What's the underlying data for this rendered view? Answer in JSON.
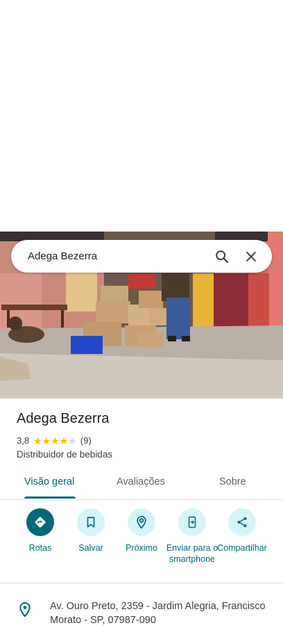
{
  "search": {
    "query": "Adega Bezerra"
  },
  "place": {
    "name": "Adega Bezerra",
    "rating": "3,8",
    "rating_value": 3.8,
    "review_count": "(9)",
    "category": "Distribuidor de bebidas"
  },
  "tabs": [
    {
      "label": "Visão geral",
      "active": true
    },
    {
      "label": "Avaliações",
      "active": false
    },
    {
      "label": "Sobre",
      "active": false
    }
  ],
  "actions": [
    {
      "label": "Rotas",
      "icon": "directions-icon"
    },
    {
      "label": "Salvar",
      "icon": "bookmark-icon"
    },
    {
      "label": "Próximo",
      "icon": "nearby-icon"
    },
    {
      "label": "Enviar para o smartphone",
      "icon": "send-to-phone-icon"
    },
    {
      "label": "Compartilhar",
      "icon": "share-icon"
    }
  ],
  "address": {
    "text": "Av. Ouro Preto, 2359 - Jardim Alegria, Francisco Morato - SP, 07987-090"
  },
  "colors": {
    "accent": "#00697a",
    "accent_light": "#d6f5fb",
    "star": "#fbbc04"
  }
}
